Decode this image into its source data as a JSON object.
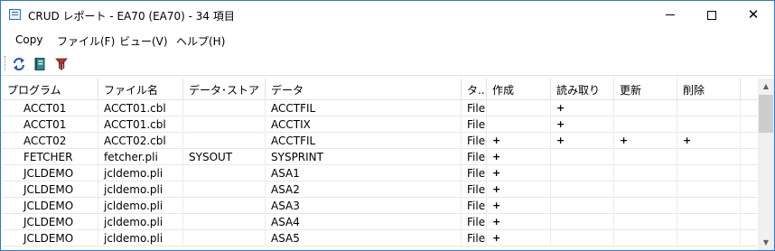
{
  "window": {
    "title": "CRUD レポート - EA70 (EA70) - 34 項目"
  },
  "menu": {
    "items": [
      {
        "label": "Copy"
      },
      {
        "label": "ファイル(F)"
      },
      {
        "label": "ビュー(V)"
      },
      {
        "label": "ヘルプ(H)"
      }
    ]
  },
  "toolbar": {
    "buttons": [
      {
        "icon": "refresh-icon"
      },
      {
        "icon": "book-icon"
      },
      {
        "icon": "filter-icon"
      }
    ]
  },
  "table": {
    "columns": [
      "プログラム",
      "ファイル名",
      "データ･ストア",
      "データ",
      "タ..",
      "作成",
      "読み取り",
      "更新",
      "削除"
    ],
    "rows": [
      {
        "program": "ACCT01",
        "file": "ACCT01.cbl",
        "store": "",
        "data": "ACCTFIL",
        "type": "File",
        "create": "",
        "read": "+",
        "update": "",
        "delete": ""
      },
      {
        "program": "ACCT01",
        "file": "ACCT01.cbl",
        "store": "",
        "data": "ACCTIX",
        "type": "File",
        "create": "",
        "read": "+",
        "update": "",
        "delete": ""
      },
      {
        "program": "ACCT02",
        "file": "ACCT02.cbl",
        "store": "",
        "data": "ACCTFIL",
        "type": "File",
        "create": "+",
        "read": "+",
        "update": "+",
        "delete": "+"
      },
      {
        "program": "FETCHER",
        "file": "fetcher.pli",
        "store": "SYSOUT",
        "data": "SYSPRINT",
        "type": "File",
        "create": "+",
        "read": "",
        "update": "",
        "delete": ""
      },
      {
        "program": "JCLDEMO",
        "file": "jcldemo.pli",
        "store": "",
        "data": "ASA1",
        "type": "File",
        "create": "+",
        "read": "",
        "update": "",
        "delete": ""
      },
      {
        "program": "JCLDEMO",
        "file": "jcldemo.pli",
        "store": "",
        "data": "ASA2",
        "type": "File",
        "create": "+",
        "read": "",
        "update": "",
        "delete": ""
      },
      {
        "program": "JCLDEMO",
        "file": "jcldemo.pli",
        "store": "",
        "data": "ASA3",
        "type": "File",
        "create": "+",
        "read": "",
        "update": "",
        "delete": ""
      },
      {
        "program": "JCLDEMO",
        "file": "jcldemo.pli",
        "store": "",
        "data": "ASA4",
        "type": "File",
        "create": "+",
        "read": "",
        "update": "",
        "delete": ""
      },
      {
        "program": "JCLDEMO",
        "file": "jcldemo.pli",
        "store": "",
        "data": "ASA5",
        "type": "File",
        "create": "+",
        "read": "",
        "update": "",
        "delete": ""
      }
    ]
  }
}
